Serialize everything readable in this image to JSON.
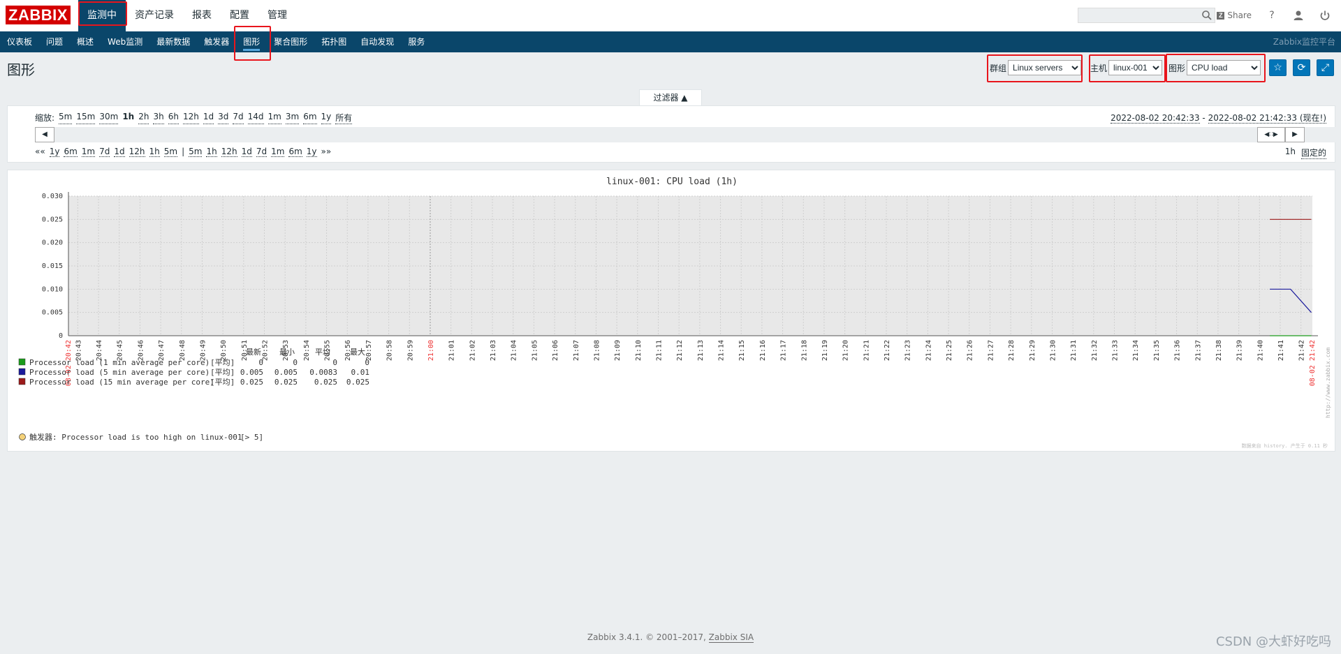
{
  "header": {
    "logo": "ZABBIX",
    "main_nav": [
      {
        "label": "监测中",
        "active": true
      },
      {
        "label": "资产记录",
        "active": false
      },
      {
        "label": "报表",
        "active": false
      },
      {
        "label": "配置",
        "active": false
      },
      {
        "label": "管理",
        "active": false
      }
    ],
    "share_label": "Share",
    "help_icon": "question-icon",
    "user_icon": "user-icon",
    "logout_icon": "power-icon"
  },
  "sub_nav": {
    "items": [
      {
        "label": "仪表板",
        "active": false
      },
      {
        "label": "问题",
        "active": false
      },
      {
        "label": "概述",
        "active": false
      },
      {
        "label": "Web监测",
        "active": false
      },
      {
        "label": "最新数据",
        "active": false
      },
      {
        "label": "触发器",
        "active": false
      },
      {
        "label": "图形",
        "active": true
      },
      {
        "label": "聚合图形",
        "active": false
      },
      {
        "label": "拓扑图",
        "active": false
      },
      {
        "label": "自动发现",
        "active": false
      },
      {
        "label": "服务",
        "active": false
      }
    ],
    "brand": "Zabbix监控平台"
  },
  "page": {
    "title": "图形",
    "group_label": "群组",
    "group_value": "Linux servers",
    "host_label": "主机",
    "host_value": "linux-001",
    "graph_label": "图形",
    "graph_value": "CPU load"
  },
  "filter": {
    "tab_label": "过滤器 ▲",
    "zoom_label": "缩放:",
    "zoom_options": [
      "5m",
      "15m",
      "30m",
      "1h",
      "2h",
      "3h",
      "6h",
      "12h",
      "1d",
      "3d",
      "7d",
      "14d",
      "1m",
      "3m",
      "6m",
      "1y",
      "所有"
    ],
    "zoom_selected": "1h",
    "range_from": "2022-08-02 20:42:33",
    "range_sep": " - ",
    "range_to": "2022-08-02 21:42:33 (现在!)",
    "nav_back": [
      "««",
      "1y",
      "6m",
      "1m",
      "7d",
      "1d",
      "12h",
      "1h",
      "5m"
    ],
    "nav_sep": "|",
    "nav_forward": [
      "5m",
      "1h",
      "12h",
      "1d",
      "7d",
      "1m",
      "6m",
      "1y",
      "»»"
    ],
    "period": "1h",
    "fixed_label": "固定的"
  },
  "chart_data": {
    "type": "line",
    "title": "linux-001: CPU load (1h)",
    "ylim": [
      0,
      0.03
    ],
    "yticks": [
      "0.030",
      "0.025",
      "0.020",
      "0.015",
      "0.010",
      "0.005",
      "0"
    ],
    "x_start_label": "08-02 20:42",
    "x_end_label": "08-02 21:42",
    "x_ticks": [
      "20:43",
      "20:44",
      "20:45",
      "20:46",
      "20:47",
      "20:48",
      "20:49",
      "20:50",
      "20:51",
      "20:52",
      "20:53",
      "20:54",
      "20:55",
      "20:56",
      "20:57",
      "20:58",
      "20:59",
      "21:00",
      "21:01",
      "21:02",
      "21:03",
      "21:04",
      "21:05",
      "21:06",
      "21:07",
      "21:08",
      "21:09",
      "21:10",
      "21:11",
      "21:12",
      "21:13",
      "21:14",
      "21:15",
      "21:16",
      "21:17",
      "21:18",
      "21:19",
      "21:20",
      "21:21",
      "21:22",
      "21:23",
      "21:24",
      "21:25",
      "21:26",
      "21:27",
      "21:28",
      "21:29",
      "21:30",
      "21:31",
      "21:32",
      "21:33",
      "21:34",
      "21:35",
      "21:36",
      "21:37",
      "21:38",
      "21:39",
      "21:40",
      "21:41",
      "21:42"
    ],
    "series": [
      {
        "name": "Processor load (1 min average per core)",
        "color": "#1a9c1a",
        "x": [
          "21:40.5",
          "21:41",
          "21:42",
          "21:42.5"
        ],
        "values": [
          0,
          0,
          0,
          0
        ]
      },
      {
        "name": "Processor load (5 min average per core)",
        "color": "#1a1a9c",
        "x": [
          "21:40.5",
          "21:41",
          "21:41.5",
          "21:42.5"
        ],
        "values": [
          0.01,
          0.01,
          0.01,
          0.005
        ]
      },
      {
        "name": "Processor load (15 min average per core)",
        "color": "#9c1a1a",
        "x": [
          "21:40.5",
          "21:41",
          "21:42",
          "21:42.5"
        ],
        "values": [
          0.025,
          0.025,
          0.025,
          0.025
        ]
      }
    ],
    "legend_headers": [
      "最新",
      "最小",
      "平均",
      "最大"
    ],
    "legend_rows": [
      {
        "name": "Processor load (1 min average per core)",
        "func": "[平均]",
        "last": "0",
        "min": "0",
        "avg": "0",
        "max": "0",
        "color": "#1a9c1a"
      },
      {
        "name": "Processor load (5 min average per core)",
        "func": "[平均]",
        "last": "0.005",
        "min": "0.005",
        "avg": "0.0083",
        "max": "0.01",
        "color": "#1a1a9c"
      },
      {
        "name": "Processor load (15 min average per core)",
        "func": "[平均]",
        "last": "0.025",
        "min": "0.025",
        "avg": "0.025",
        "max": "0.025",
        "color": "#9c1a1a"
      }
    ],
    "trigger_label": "触发器: Processor load is too high on linux-001",
    "trigger_value": "[> 5]",
    "trigger_color": "#f5d27a",
    "side_text": "http://www.zabbix.com",
    "corner_text": "数据来自 history. 产生于 0.11 秒"
  },
  "footer": {
    "text": "Zabbix 3.4.1. © 2001–2017,",
    "link": "Zabbix SIA"
  },
  "watermark": "CSDN @大虾好吃吗"
}
